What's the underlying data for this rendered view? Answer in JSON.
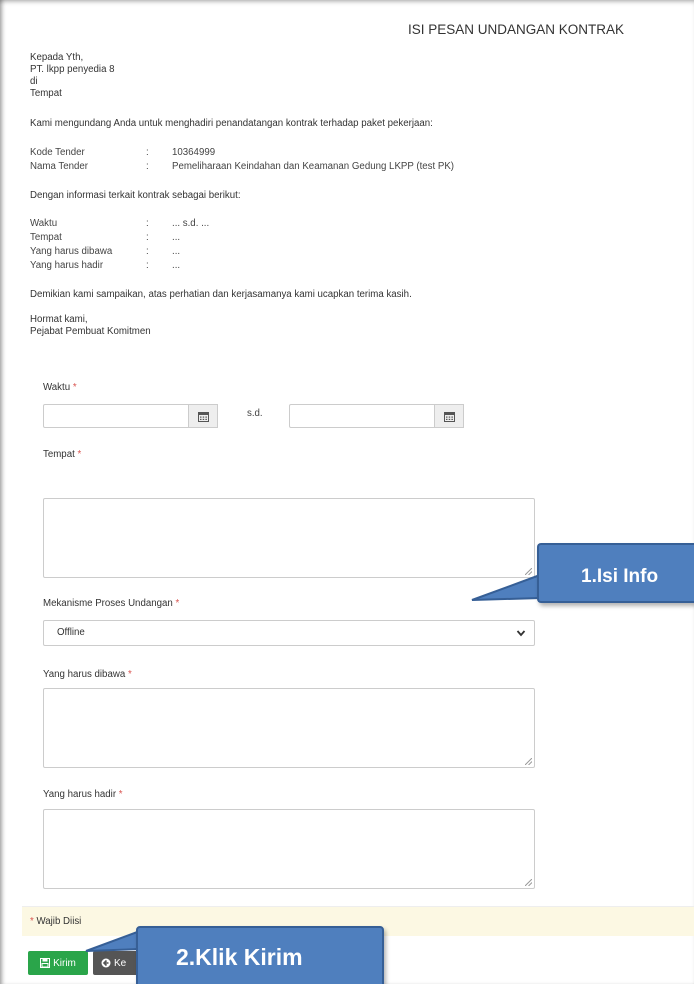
{
  "page": {
    "title": "ISI PESAN UNDANGAN KONTRAK"
  },
  "letter": {
    "greeting": "Kepada Yth,",
    "recipient": "PT. lkpp penyedia 8",
    "di": "di",
    "place": "Tempat",
    "intro": "Kami mengundang Anda untuk menghadiri penandatangan kontrak terhadap paket pekerjaan:",
    "tender_rows": [
      {
        "label": "Kode Tender",
        "sep": ":",
        "value": "10364999"
      },
      {
        "label": "Nama Tender",
        "sep": ":",
        "value": "Pemeliharaan Keindahan dan Keamanan Gedung LKPP (test PK)"
      }
    ],
    "info_intro": "Dengan informasi terkait kontrak sebagai berikut:",
    "info_rows": [
      {
        "label": "Waktu",
        "sep": ":",
        "value": "... s.d. ..."
      },
      {
        "label": "Tempat",
        "sep": ":",
        "value": "..."
      },
      {
        "label": "Yang harus dibawa",
        "sep": ":",
        "value": "..."
      },
      {
        "label": "Yang harus hadir",
        "sep": ":",
        "value": "..."
      }
    ],
    "closing": "Demikian kami sampaikan, atas perhatian dan kerjasamanya kami ucapkan terima kasih.",
    "regards": "Hormat kami,",
    "signer": "Pejabat Pembuat Komitmen"
  },
  "form": {
    "required_mark": "*",
    "waktu_label": "Waktu",
    "waktu_start_value": "",
    "waktu_end_value": "",
    "sd_label": "s.d.",
    "tempat_label": "Tempat",
    "mekanisme_label": "Mekanisme Proses Undangan",
    "mekanisme_value": "Offline",
    "dibawa_label": "Yang harus dibawa",
    "hadir_label": "Yang harus hadir",
    "wajib_note": "Wajib Diisi"
  },
  "buttons": {
    "kirim": "Kirim",
    "kembali": "Ke"
  },
  "callouts": {
    "step1": "1.Isi Info",
    "step2": "2.Klik Kirim"
  },
  "colors": {
    "kirim_button": "#2aa54a",
    "callout_fill": "#4f7fbe",
    "required": "#d9534f",
    "note_background": "#fcf8e3"
  },
  "icons": {
    "calendar": "calendar-icon",
    "floppy": "floppy-disk-icon",
    "back": "arrow-circle-left-icon",
    "chevron": "chevron-down-icon"
  }
}
